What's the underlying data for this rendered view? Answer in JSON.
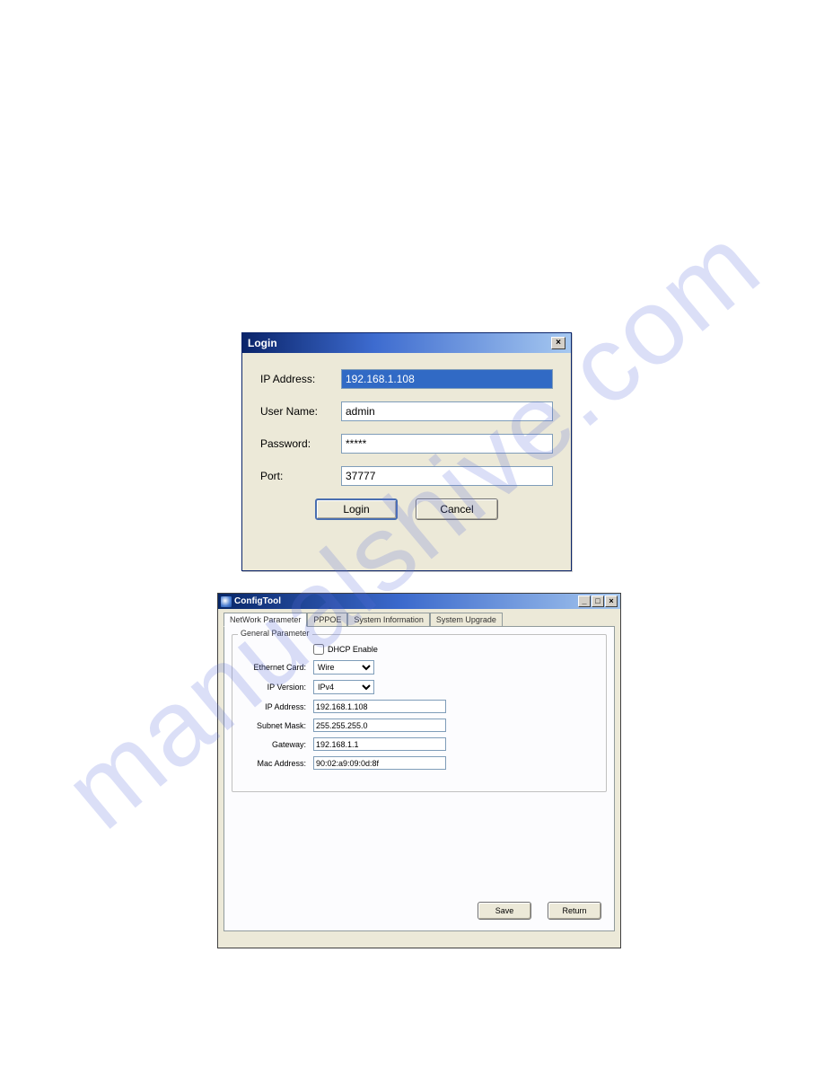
{
  "watermark": "manualshive.com",
  "login": {
    "title": "Login",
    "close": "×",
    "labels": {
      "ip": "IP Address:",
      "user": "User Name:",
      "pass": "Password:",
      "port": "Port:"
    },
    "values": {
      "ip": "192.168.1.108",
      "user": "admin",
      "pass": "*****",
      "port": "37777"
    },
    "buttons": {
      "login": "Login",
      "cancel": "Cancel"
    }
  },
  "config": {
    "title": "ConfigTool",
    "winbtns": {
      "min": "_",
      "max": "□",
      "close": "×"
    },
    "tabs": [
      "NetWork Parameter",
      "PPPOE",
      "System Information",
      "System Upgrade"
    ],
    "fieldset_legend": "General Parameter",
    "labels": {
      "dhcp": "DHCP Enable",
      "ethernet": "Ethernet Card:",
      "ipver": "IP Version:",
      "ip": "IP Address:",
      "subnet": "Subnet Mask:",
      "gateway": "Gateway:",
      "mac": "Mac Address:"
    },
    "values": {
      "ethernet": "Wire",
      "ipver": "IPv4",
      "ip": "192.168.1.108",
      "subnet": "255.255.255.0",
      "gateway": "192.168.1.1",
      "mac": "90:02:a9:09:0d:8f"
    },
    "buttons": {
      "save": "Save",
      "return": "Return"
    }
  }
}
